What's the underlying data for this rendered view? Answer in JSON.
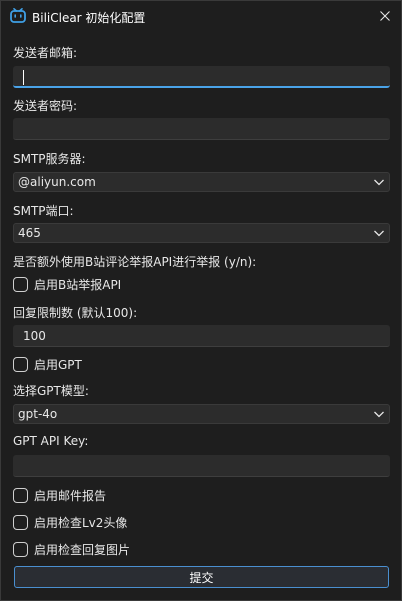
{
  "window": {
    "title": "BiliClear 初始化配置"
  },
  "form": {
    "email_label": "发送者邮箱:",
    "email_value": "",
    "password_label": "发送者密码:",
    "password_value": "",
    "smtp_server_label": "SMTP服务器:",
    "smtp_server_value": "@aliyun.com",
    "smtp_port_label": "SMTP端口:",
    "smtp_port_value": "465",
    "report_question": "是否额外使用B站评论举报API进行举报 (y/n):",
    "enable_bili_report_label": "启用B站举报API",
    "enable_bili_report_checked": false,
    "reply_limit_label": "回复限制数 (默认100):",
    "reply_limit_value": "100",
    "enable_gpt_label": "启用GPT",
    "enable_gpt_checked": false,
    "gpt_model_label": "选择GPT模型:",
    "gpt_model_value": "gpt-4o",
    "gpt_api_key_label": "GPT API Key:",
    "gpt_api_key_value": "",
    "enable_email_report_label": "启用邮件报告",
    "enable_email_report_checked": false,
    "enable_lv2_avatar_label": "启用检查Lv2头像",
    "enable_lv2_avatar_checked": false,
    "enable_reply_image_label": "启用检查回复图片",
    "enable_reply_image_checked": false,
    "submit_label": "提交"
  },
  "colors": {
    "background": "#1e1e1e",
    "field": "#2c2c2c",
    "accent": "#4aa3e8"
  },
  "icons": {
    "app": "bilibili-tv-icon",
    "close": "close-icon",
    "dropdown": "chevron-down-icon"
  }
}
